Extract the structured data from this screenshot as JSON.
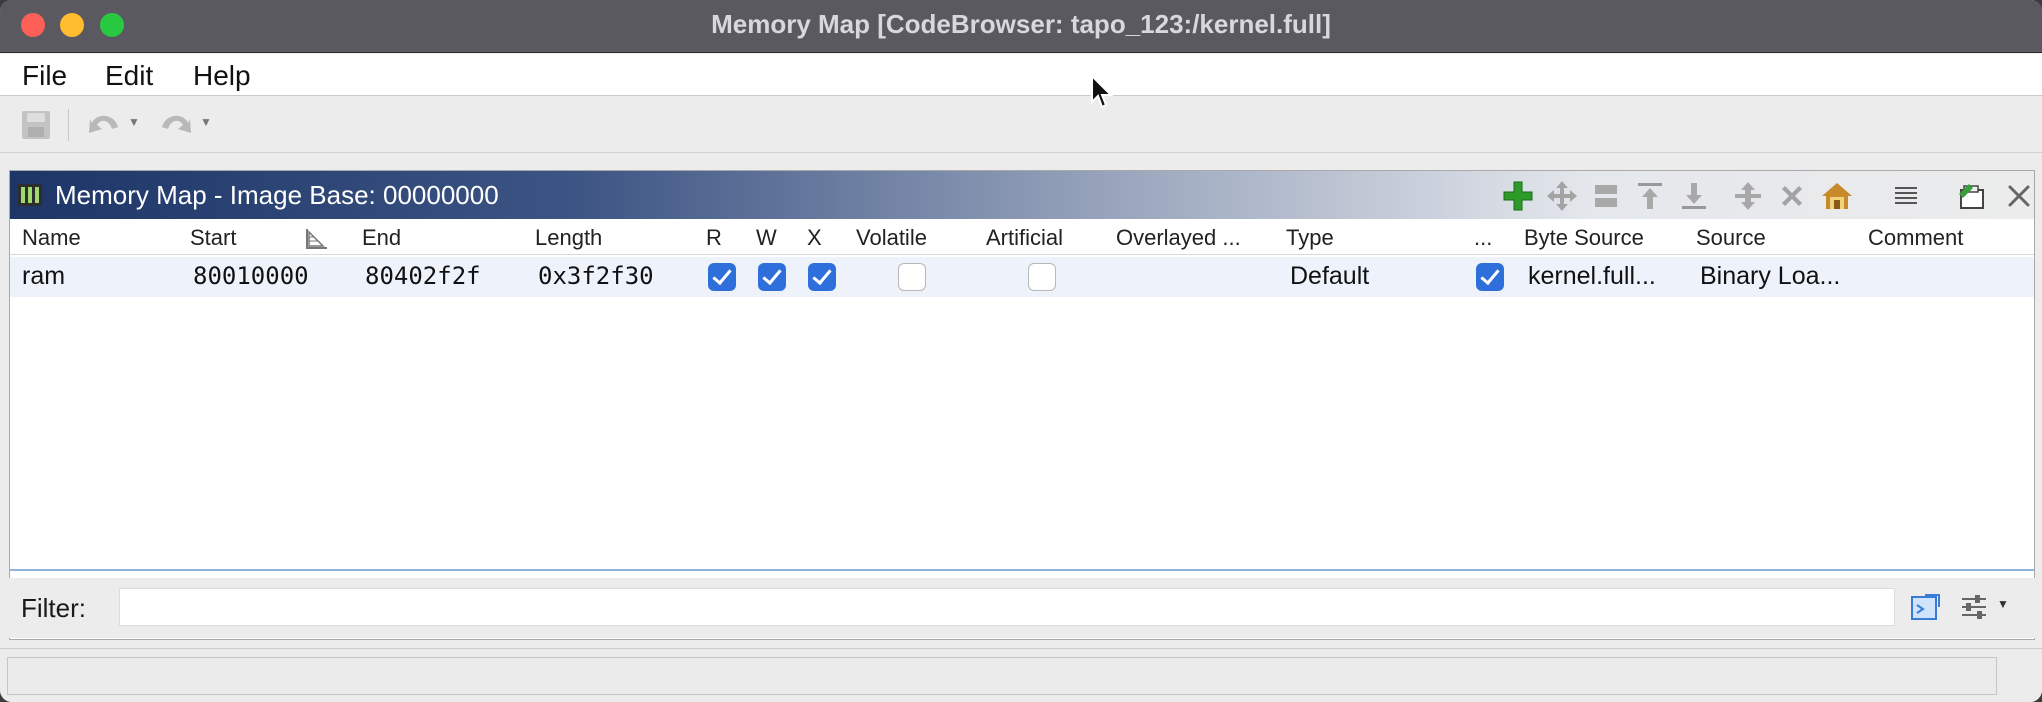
{
  "window": {
    "title": "Memory Map [CodeBrowser: tapo_123:/kernel.full]"
  },
  "menubar": {
    "items": [
      {
        "label": "File"
      },
      {
        "label": "Edit"
      },
      {
        "label": "Help"
      }
    ]
  },
  "toolbar": {
    "icons": [
      "save-icon",
      "undo-icon",
      "redo-icon"
    ]
  },
  "panel": {
    "title": "Memory Map - Image Base: 00000000",
    "header_icons": [
      "add-block-icon",
      "move-block-icon",
      "split-block-icon",
      "expand-up-icon",
      "expand-down-icon",
      "merge-blocks-icon",
      "delete-block-icon",
      "set-image-base-icon",
      "column-chooser-icon",
      "snapshot-icon",
      "close-icon"
    ]
  },
  "table": {
    "columns": {
      "name": "Name",
      "start": "Start",
      "end": "End",
      "length": "Length",
      "r": "R",
      "w": "W",
      "x": "X",
      "volatile": "Volatile",
      "artificial": "Artificial",
      "overlayed": "Overlayed ...",
      "type": "Type",
      "initialized": "...",
      "byte_source": "Byte Source",
      "source": "Source",
      "comment": "Comment"
    },
    "rows": [
      {
        "name": "ram",
        "start": "80010000",
        "end": "80402f2f",
        "length": "0x3f2f30",
        "r": true,
        "w": true,
        "x": true,
        "volatile": false,
        "artificial": false,
        "overlayed": "",
        "type": "Default",
        "initialized": true,
        "byte_source": "kernel.full...",
        "source": "Binary Loa...",
        "comment": ""
      }
    ]
  },
  "filter": {
    "label": "Filter:",
    "value": ""
  },
  "colors": {
    "titlebar": "#5a5960",
    "panel_header_start": "#1d3567",
    "checkbox_checked": "#2f6fdb",
    "add_icon": "#2e9a28"
  }
}
